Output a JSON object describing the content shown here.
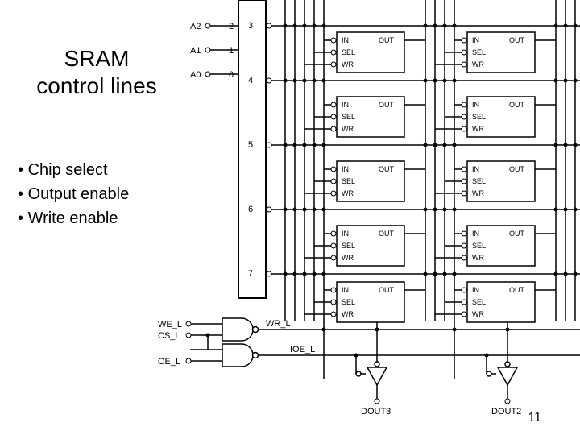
{
  "title_line1": "SRAM",
  "title_line2": "control lines",
  "bullets": {
    "b1": "Chip select",
    "b2": "Output enable",
    "b3": "Write enable"
  },
  "addr": {
    "a2": "A2",
    "a1": "A1",
    "a0": "A0",
    "a2n": "2",
    "a1n": "1",
    "a0n": "0"
  },
  "rows": {
    "r3": "3",
    "r4": "4",
    "r5": "5",
    "r6": "6",
    "r7": "7"
  },
  "ctrl": {
    "we": "WE_L",
    "cs": "CS_L",
    "oe": "OE_L",
    "wr": "WR_L",
    "ioe": "IOE_L"
  },
  "cell": {
    "in": "IN",
    "out": "OUT",
    "sel": "SEL",
    "wr": "WR"
  },
  "dout": {
    "d3": "DOUT3",
    "d2": "DOUT2"
  },
  "pagenum": "11"
}
